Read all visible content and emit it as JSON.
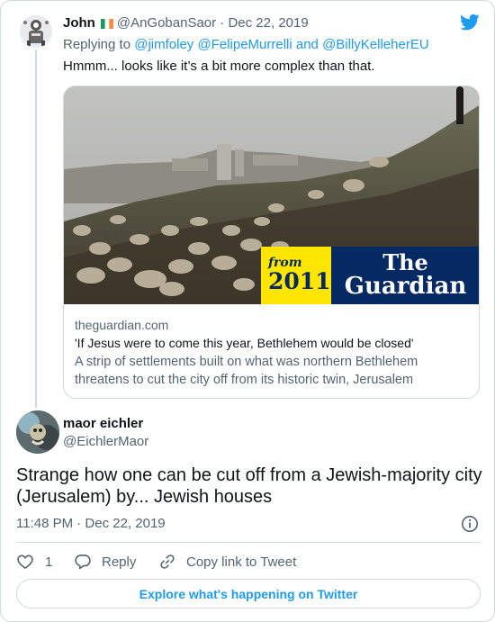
{
  "reply_tweet": {
    "display_name": "John",
    "flag": "ireland-flag",
    "handle_date": "@AnGobanSaor · Dec 22, 2019",
    "replying_prefix": "Replying to",
    "replying_handles": "@jimfoley @FelipeMurrelli and @BillyKelleherEU",
    "text": "Hmmm... looks like it’s a bit more complex than that."
  },
  "link_card": {
    "image_badge": {
      "from_label": "from",
      "year": "2011",
      "publisher_line1": "The",
      "publisher_line2": "Guardian"
    },
    "domain": "theguardian.com",
    "title": "'If Jesus were to come this year, Bethlehem would be closed'",
    "description": "A strip of settlements built on what was northern Bethlehem threatens to cut the city off from its historic twin, Jerusalem"
  },
  "main_tweet": {
    "display_name": "maor eichler",
    "handle": "@EichlerMaor",
    "text": "Strange how one can be cut off from a Jewish-majority city (Jerusalem) by... Jewish houses",
    "timestamp": "11:48 PM · Dec 22, 2019"
  },
  "actions": {
    "like_count": "1",
    "reply_label": "Reply",
    "copy_label": "Copy link to Tweet"
  },
  "explore_label": "Explore what's happening on Twitter",
  "icons": [
    "twitter-logo-icon",
    "info-icon",
    "heart-icon",
    "reply-icon",
    "link-icon"
  ],
  "colors": {
    "twitter_blue": "#1d9bf0",
    "guardian_blue": "#052962",
    "guardian_yellow": "#ffe500",
    "secondary_text": "#536471",
    "border": "#cfd9de"
  }
}
